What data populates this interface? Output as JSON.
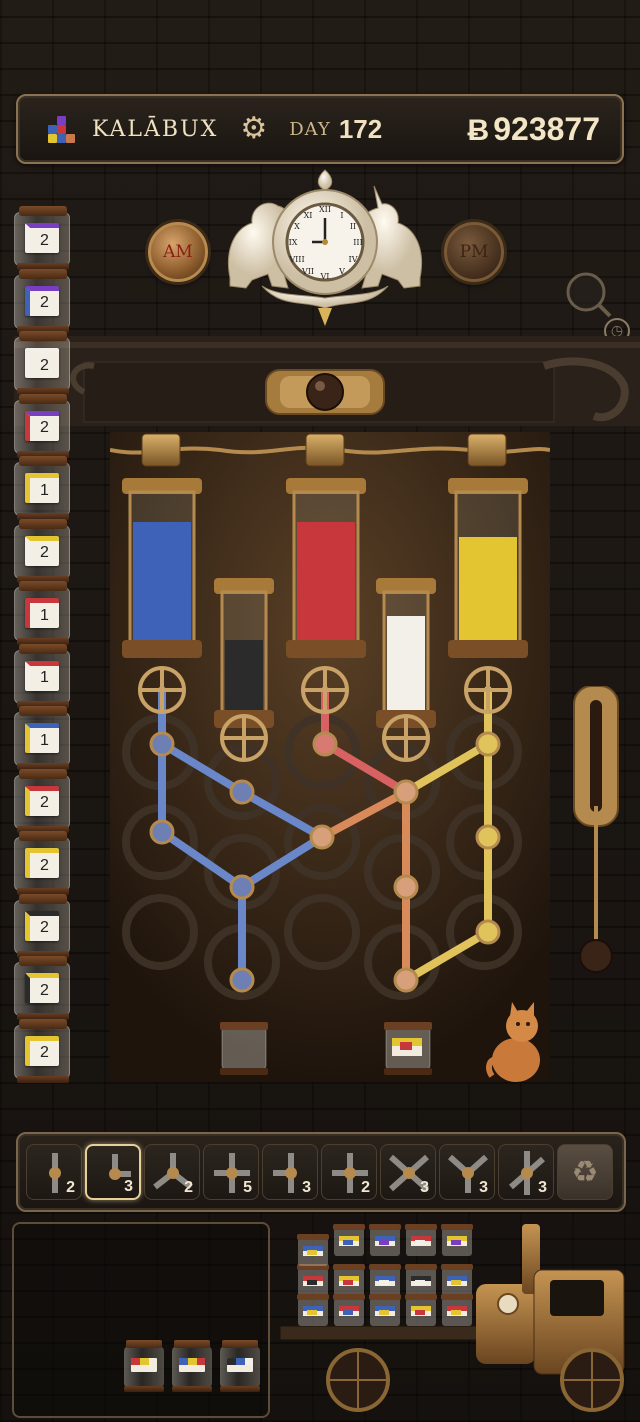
{
  "header": {
    "title": "KALĀBUX",
    "day_label": "DAY",
    "day_value": "172",
    "currency_symbol": "Ƀ",
    "money": "923877"
  },
  "clock": {
    "am_label": "AM",
    "pm_label": "PM"
  },
  "colors": {
    "blue": "#3d62b8",
    "red": "#c7373c",
    "yellow": "#e2c531",
    "black": "#2b2b2b",
    "white": "#f3f0ea",
    "purple": "#7a3ec2",
    "orange": "#c9784a",
    "brass": "#b58a4e"
  },
  "order_stack": [
    {
      "count": "2",
      "tag": [
        "purple",
        "white"
      ]
    },
    {
      "count": "2",
      "tag": [
        "purple",
        "blue"
      ]
    },
    {
      "count": "2",
      "tag": [
        "white",
        "white"
      ]
    },
    {
      "count": "2",
      "tag": [
        "purple",
        "red"
      ]
    },
    {
      "count": "1",
      "tag": [
        "yellow",
        "yellow"
      ]
    },
    {
      "count": "2",
      "tag": [
        "yellow",
        "white"
      ]
    },
    {
      "count": "1",
      "tag": [
        "red",
        "red"
      ]
    },
    {
      "count": "1",
      "tag": [
        "red",
        "white"
      ]
    },
    {
      "count": "1",
      "tag": [
        "blue",
        "yellow"
      ]
    },
    {
      "count": "2",
      "tag": [
        "red",
        "yellow"
      ]
    },
    {
      "count": "2",
      "tag": [
        "yellow",
        "yellow"
      ]
    },
    {
      "count": "2",
      "tag": [
        "black",
        "yellow"
      ]
    },
    {
      "count": "2",
      "tag": [
        "yellow",
        "black"
      ]
    },
    {
      "count": "2",
      "tag": [
        "yellow",
        "yellow"
      ]
    }
  ],
  "tanks": [
    {
      "name": "blue-tank",
      "color": "blue",
      "fill": 0.8
    },
    {
      "name": "black-tank",
      "color": "black",
      "fill": 0.6
    },
    {
      "name": "red-tank",
      "color": "red",
      "fill": 0.8
    },
    {
      "name": "white-tank",
      "color": "white",
      "fill": 0.8
    },
    {
      "name": "yellow-tank",
      "color": "yellow",
      "fill": 0.7
    }
  ],
  "toolbar": {
    "tools": [
      {
        "name": "pipe-straight-vertical",
        "count": "2",
        "selected": false
      },
      {
        "name": "pipe-elbow",
        "count": "3",
        "selected": true
      },
      {
        "name": "pipe-y-split",
        "count": "2",
        "selected": false
      },
      {
        "name": "pipe-cross-up",
        "count": "5",
        "selected": false
      },
      {
        "name": "pipe-t-left",
        "count": "3",
        "selected": false
      },
      {
        "name": "pipe-tee-right",
        "count": "2",
        "selected": false
      },
      {
        "name": "pipe-x-cross",
        "count": "3",
        "selected": false
      },
      {
        "name": "pipe-y-merge",
        "count": "3",
        "selected": false
      },
      {
        "name": "pipe-diagonal",
        "count": "3",
        "selected": false
      }
    ],
    "recycle_icon": "recycle-icon"
  },
  "tray_jars": [
    {
      "tag": [
        "red",
        "yellow"
      ]
    },
    {
      "tag": [
        "blue",
        "yellow",
        "red"
      ]
    },
    {
      "tag": [
        "black",
        "blue",
        "white"
      ]
    }
  ],
  "truck_jars": [
    {
      "tag": [
        "yellow",
        "blue"
      ]
    },
    {
      "tag": [
        "blue",
        "purple"
      ]
    },
    {
      "tag": [
        "red",
        "white"
      ]
    },
    {
      "tag": [
        "yellow",
        "purple"
      ]
    },
    {
      "tag": [
        "yellow",
        "red"
      ]
    },
    {
      "tag": [
        "blue",
        "white"
      ]
    },
    {
      "tag": [
        "black",
        "white"
      ]
    },
    {
      "tag": [
        "blue",
        "yellow"
      ]
    },
    {
      "tag": [
        "red",
        "black"
      ]
    },
    {
      "tag": [
        "blue",
        "yellow"
      ]
    },
    {
      "tag": [
        "red",
        "blue"
      ]
    },
    {
      "tag": [
        "blue",
        "yellow"
      ]
    },
    {
      "tag": [
        "yellow",
        "red"
      ]
    },
    {
      "tag": [
        "red",
        "yellow"
      ]
    },
    {
      "tag": [
        "blue",
        "yellow"
      ]
    }
  ]
}
